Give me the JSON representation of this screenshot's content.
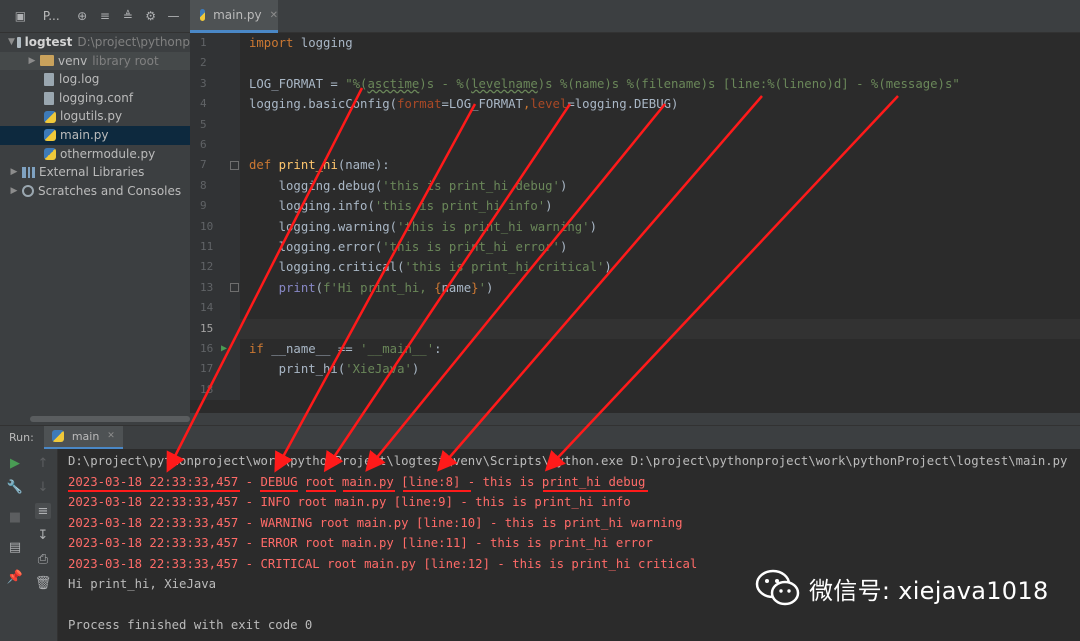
{
  "project_panel": {
    "title": "P...",
    "tree": [
      {
        "name": "logtest",
        "suffix": "D:\\project\\pythonp"
      },
      {
        "name": "venv",
        "suffix": "library root"
      },
      {
        "name": "log.log"
      },
      {
        "name": "logging.conf"
      },
      {
        "name": "logutils.py"
      },
      {
        "name": "main.py"
      },
      {
        "name": "othermodule.py"
      },
      {
        "name": "External Libraries"
      },
      {
        "name": "Scratches and Consoles"
      }
    ]
  },
  "editor": {
    "tab_label": "main.py",
    "line_numbers": [
      "1",
      "2",
      "3",
      "4",
      "5",
      "6",
      "7",
      "8",
      "9",
      "10",
      "11",
      "12",
      "13",
      "14",
      "15",
      "16",
      "17",
      "18"
    ],
    "code": {
      "l1_kw": "import",
      "l1_rest": " logging",
      "l3_a": "LOG_FORMAT = ",
      "l3_b": "\"%(",
      "l3_c": "asctime",
      "l3_d": ")s - %(",
      "l3_e": "levelname",
      "l3_f": ")s %(name)s %(filename)s [line:%(lineno)d] - %(message)s\"",
      "l4_a": "logging.basicConfig(",
      "l4_b": "format",
      "l4_c": "=LOG_FORMAT",
      "l4_d": ",",
      "l4_e": "level",
      "l4_f": "=logging.DEBUG)",
      "l7_kw": "def",
      "l7_fn": "print_hi",
      "l7_rest": "(name):",
      "l8_a": "    logging.debug(",
      "l8_s": "'this is print_hi debug'",
      "l8_b": ")",
      "l9_a": "    logging.info(",
      "l9_s": "'this is print_hi info'",
      "l9_b": ")",
      "l10_a": "    logging.warning(",
      "l10_s": "'this is print_hi warning'",
      "l10_b": ")",
      "l11_a": "    logging.error(",
      "l11_s": "'this is print_hi error'",
      "l11_b": ")",
      "l12_a": "    logging.critical(",
      "l12_s": "'this is print_hi critical'",
      "l12_b": ")",
      "l13_a": "    ",
      "l13_fn": "print",
      "l13_b": "(",
      "l13_s1": "f'Hi print_hi, ",
      "l13_br1": "{",
      "l13_var": "name",
      "l13_br2": "}",
      "l13_s2": "'",
      "l13_c": ")",
      "l16_kw": "if",
      "l16_a": " __name__ == ",
      "l16_s": "'__main__'",
      "l16_b": ":",
      "l17_a": "    print_hi(",
      "l17_s": "'XieJava'",
      "l17_b": ")"
    }
  },
  "run": {
    "label": "Run:",
    "tab_label": "main",
    "console": [
      {
        "text": "D:\\project\\pythonproject\\work\\pythonProject\\logtest\\venv\\Scripts\\python.exe D:\\project\\pythonproject\\work\\pythonProject\\logtest\\main.py",
        "kind": "std"
      },
      {
        "text": "2023-03-18 22:33:33,457 - DEBUG root main.py [line:8] - this is print_hi debug",
        "kind": "err"
      },
      {
        "text": "2023-03-18 22:33:33,457 - INFO root main.py [line:9] - this is print_hi info",
        "kind": "err"
      },
      {
        "text": "2023-03-18 22:33:33,457 - WARNING root main.py [line:10] - this is print_hi warning",
        "kind": "err"
      },
      {
        "text": "2023-03-18 22:33:33,457 - ERROR root main.py [line:11] - this is print_hi error",
        "kind": "err"
      },
      {
        "text": "2023-03-18 22:33:33,457 - CRITICAL root main.py [line:12] - this is print_hi critical",
        "kind": "err"
      },
      {
        "text": "Hi print_hi, XieJava",
        "kind": "std"
      },
      {
        "text": "",
        "kind": "std"
      },
      {
        "text": "Process finished with exit code 0",
        "kind": "std"
      }
    ]
  },
  "watermark": {
    "text": "微信号: xiejava1018"
  },
  "colors": {
    "annotation": "#ff1a1a",
    "accent": "#4a88c7",
    "error_text": "#ff6b68"
  }
}
